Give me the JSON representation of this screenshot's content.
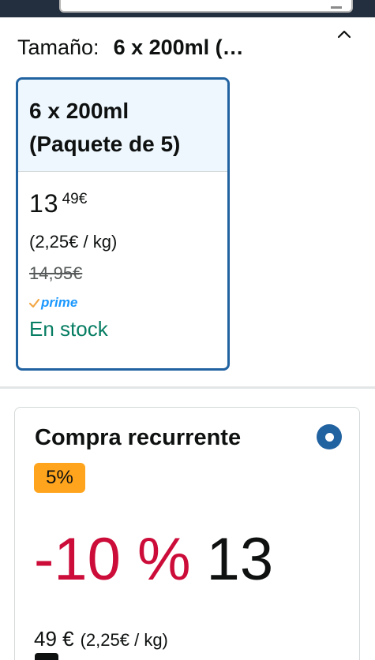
{
  "colors": {
    "accent_blue": "#2162a1",
    "selected_bg": "#edf7fd",
    "stock_green": "#067d62",
    "discount_red": "#cc0c39",
    "badge_orange": "#ffa41c",
    "prime_blue": "#1a98ff",
    "header_dark": "#232f3e"
  },
  "size_selector": {
    "label": "Tamaño:",
    "value": "6 x 200ml (…",
    "collapse_icon": "chevron-up-icon"
  },
  "variant": {
    "name_line1": "6 x 200ml",
    "name_line2": "(Paquete de 5)",
    "price_whole": "13",
    "price_fraction": "49€",
    "unit_price": "(2,25€ / kg)",
    "was_price": "14,95€",
    "prime_label": "prime",
    "prime_icon": "check-icon",
    "stock": "En stock",
    "selected": true
  },
  "subscription": {
    "title": "Compra recurrente",
    "badge": "5%",
    "discount": "-10 %",
    "price_whole": "13",
    "price_fraction": "49 €",
    "unit_price": "(2,25€ / kg)",
    "selected": true
  }
}
